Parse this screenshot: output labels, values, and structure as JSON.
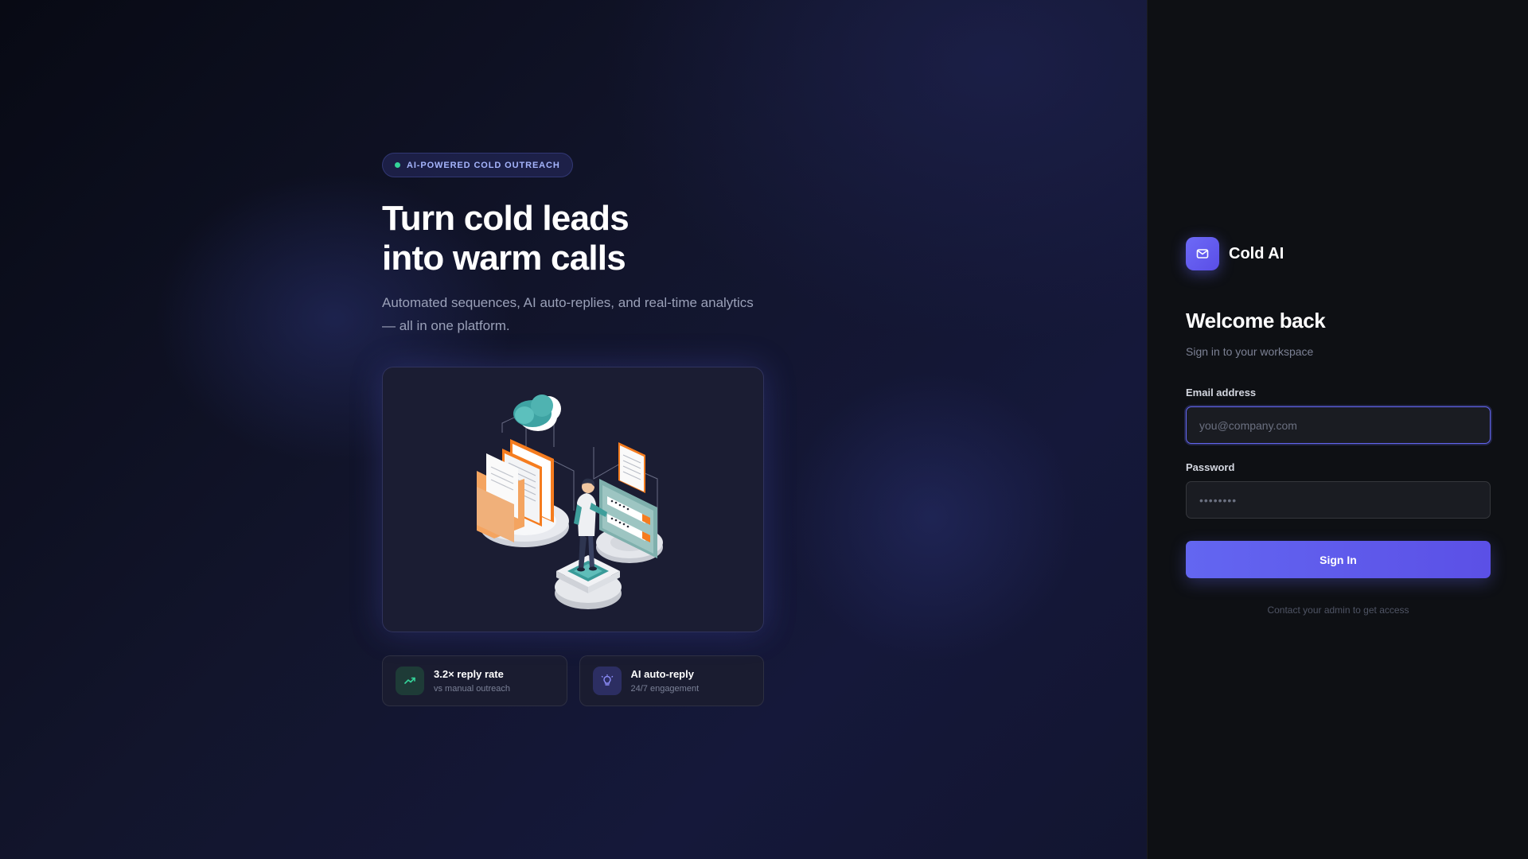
{
  "hero": {
    "badge": "AI-POWERED COLD OUTREACH",
    "headline_line1": "Turn cold leads",
    "headline_line2": "into warm calls",
    "subtitle": "Automated sequences, AI auto-replies, and real-time analytics — all in one platform.",
    "illustration": "isometric-person-at-login-screen-with-documents-and-cloud",
    "stats": [
      {
        "icon": "trending-up-icon",
        "title": "3.2× reply rate",
        "subtitle": "vs manual outreach",
        "accent": "#34d399"
      },
      {
        "icon": "lightbulb-icon",
        "title": "AI auto-reply",
        "subtitle": "24/7 engagement",
        "accent": "#8b8cf8"
      }
    ]
  },
  "auth": {
    "brand_icon": "mail-icon",
    "brand_name": "Cold AI",
    "welcome_title": "Welcome back",
    "welcome_subtitle": "Sign in to your workspace",
    "email_label": "Email address",
    "email_placeholder": "you@company.com",
    "email_value": "",
    "password_label": "Password",
    "password_placeholder": "••••••••",
    "password_value": "",
    "signin_label": "Sign In",
    "contact_text": "Contact your admin to get access"
  },
  "colors": {
    "accent": "#6366f1",
    "badge_dot": "#34d399",
    "badge_text": "#a5b4fc",
    "panel_bg": "#0e1014"
  }
}
